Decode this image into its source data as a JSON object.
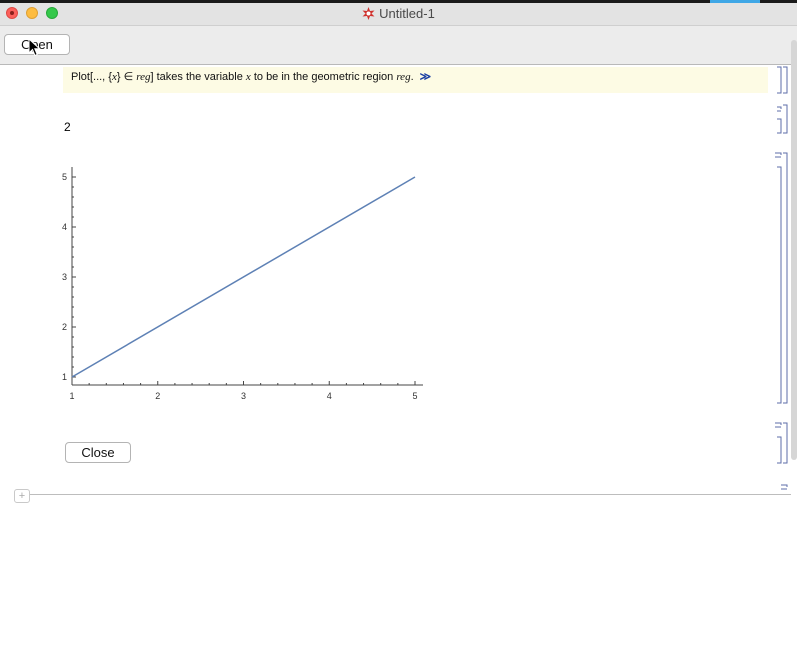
{
  "window": {
    "title": "Untitled-1"
  },
  "toolbar": {
    "open_label": "Open"
  },
  "message": {
    "lead": "Plot[..., {",
    "var1": "x",
    "mid": "} ∈ ",
    "reg1": "reg",
    "text1": "] takes the variable ",
    "var2": "x",
    "text2": " to be in the geometric region ",
    "reg2": "reg",
    "text3": ".",
    "more": "≫"
  },
  "output": {
    "value": "2"
  },
  "chart_data": {
    "type": "line",
    "x": [
      1,
      5
    ],
    "series": [
      {
        "values": [
          1,
          5
        ]
      }
    ],
    "xlim": [
      1,
      5
    ],
    "ylim": [
      1,
      5
    ],
    "x_ticks": [
      "1",
      "2",
      "3",
      "4",
      "5"
    ],
    "y_ticks": [
      "1",
      "2",
      "3",
      "4",
      "5"
    ],
    "color": "#5e81b5",
    "grid": false
  },
  "close_button": {
    "label": "Close"
  },
  "new_cell": {
    "label": "+"
  }
}
